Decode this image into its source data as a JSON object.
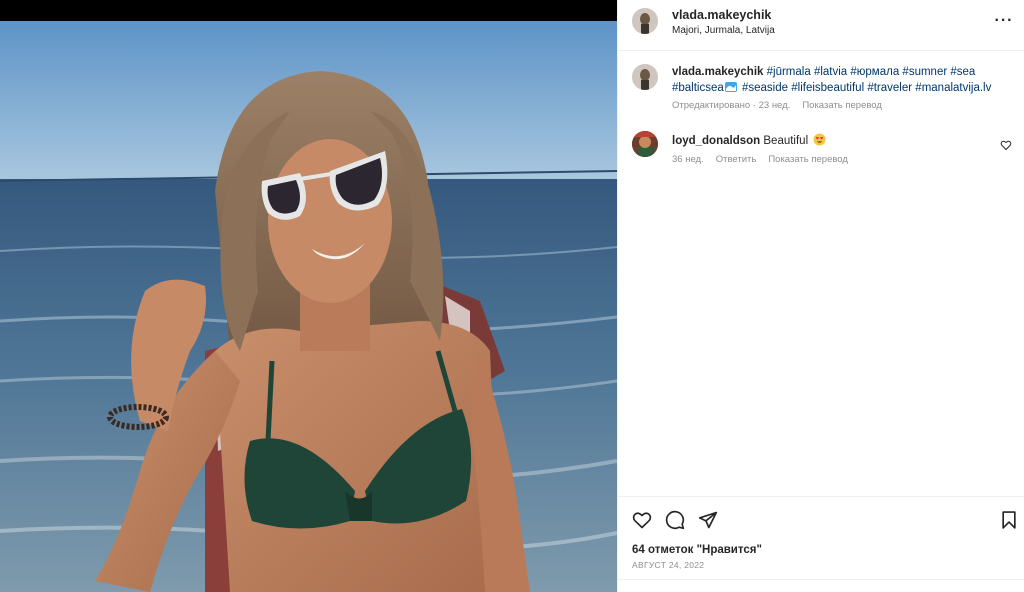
{
  "post": {
    "username": "vlada.makeychik",
    "location": "Majori, Jurmala, Latvija"
  },
  "caption": {
    "username": "vlada.makeychik",
    "hashtags_line1": [
      "#jūrmala",
      "#latvia",
      "#юрмала",
      "#sumner",
      "#sea"
    ],
    "hashtag_balticsea": "#balticsea",
    "hashtags_line2": [
      "#seaside",
      "#lifeisbeautiful",
      "#traveler",
      "#manalatvija.lv"
    ],
    "edited_label": "Отредактировано · 23 нед.",
    "translate_label": "Показать перевод"
  },
  "comment": {
    "username": "loyd_donaldson",
    "text": "Beautiful",
    "age": "36 нед.",
    "reply_label": "Ответить",
    "translate_label": "Показать перевод"
  },
  "footer": {
    "likes": "64 отметок \"Нравится\"",
    "date": "АВГУСТ 24, 2022"
  },
  "icons": {
    "more": "more-options-icon",
    "like": "heart-icon",
    "comment": "comment-bubble-icon",
    "share": "paper-plane-icon",
    "save": "bookmark-icon"
  },
  "colors": {
    "hashtag": "#00376b",
    "secondary_text": "#8e8e8e",
    "divider": "#efefef"
  }
}
